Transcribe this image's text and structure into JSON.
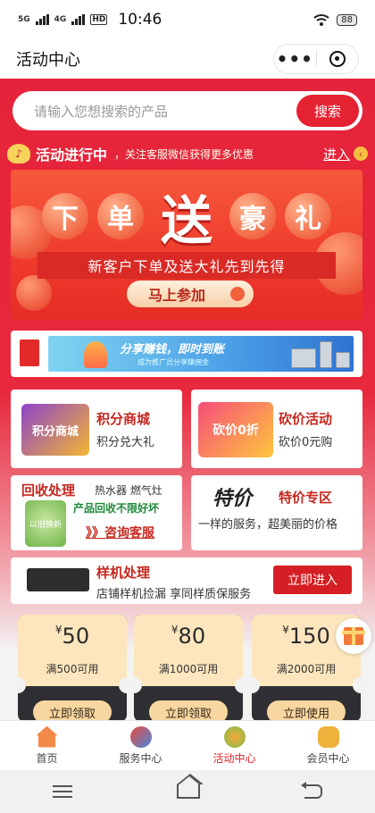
{
  "status_bar": {
    "signal_1": "5G",
    "signal_2": "4G",
    "hd": "HD",
    "time": "10:46",
    "battery": "88"
  },
  "nav": {
    "title": "活动中心",
    "more_icon": "more-dots-icon",
    "close_icon": "target-circle-icon"
  },
  "search": {
    "placeholder": "请输入您想搜索的产品",
    "button": "搜索"
  },
  "activity": {
    "title": "活动进行中",
    "subtitle": "，关注客服微信获得更多优惠",
    "enter": "进入",
    "icon": "bell-icon"
  },
  "hero": {
    "chars": [
      "下",
      "单",
      "送",
      "豪",
      "礼"
    ],
    "subtitle": "新客户下单及送大礼先到先得",
    "button": "马上参加"
  },
  "share": {
    "title": "分享赚钱，即时到账",
    "sub": "成为推广员分享赚佣金"
  },
  "cards": {
    "points_mall": {
      "title": "积分商城",
      "sub": "积分兑大礼",
      "img_text": "积分商城"
    },
    "bargain": {
      "title": "砍价活动",
      "sub": "砍价0元购",
      "img_text": "砍价0折"
    },
    "recycle": {
      "title": "回收处理",
      "tags": "热水器 燃气灶",
      "highlight": "产品回收不限好坏",
      "link": "》》咨询客服",
      "img_text": "以旧换新"
    },
    "special": {
      "title": "特价专区",
      "sub": "一样的服务，超美丽的价格",
      "img_text": "特价"
    },
    "sample": {
      "title": "样机处理",
      "sub": "店铺样机捡漏 享同样质保服务",
      "button": "立即进入"
    }
  },
  "coupons": [
    {
      "currency": "¥",
      "amount": "50",
      "condition": "满500可用",
      "button": "立即领取"
    },
    {
      "currency": "¥",
      "amount": "80",
      "condition": "满1000可用",
      "button": "立即领取"
    },
    {
      "currency": "¥",
      "amount": "150",
      "condition": "满2000可用",
      "button": "立即使用"
    }
  ],
  "tabs": [
    {
      "label": "首页",
      "icon": "home-icon"
    },
    {
      "label": "服务中心",
      "icon": "service-icon"
    },
    {
      "label": "活动中心",
      "icon": "activity-icon"
    },
    {
      "label": "会员中心",
      "icon": "member-icon"
    }
  ],
  "colors": {
    "primary_red": "#e5233a",
    "accent_gold": "#f7d6a0",
    "active_tab": "#e4252c"
  }
}
